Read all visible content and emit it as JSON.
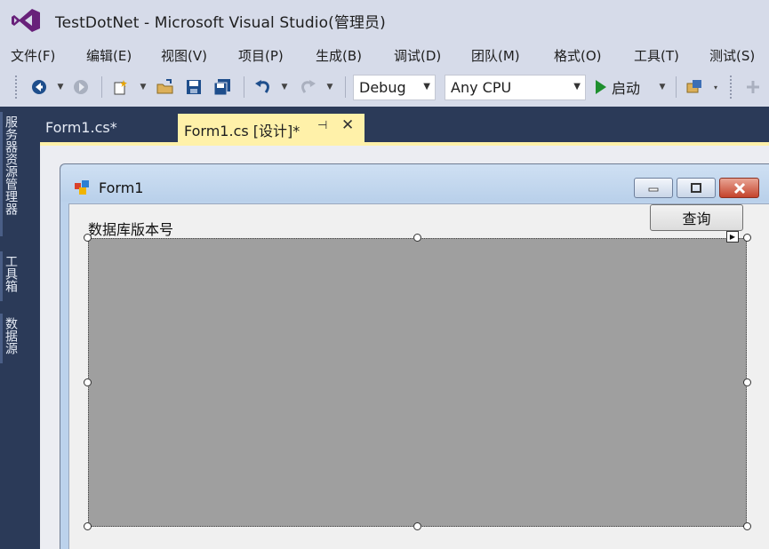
{
  "window": {
    "title": "TestDotNet - Microsoft Visual Studio(管理员)"
  },
  "menu": {
    "items": [
      "文件(F)",
      "编辑(E)",
      "视图(V)",
      "项目(P)",
      "生成(B)",
      "调试(D)",
      "团队(M)",
      "格式(O)",
      "工具(T)",
      "测试(S)"
    ]
  },
  "toolbar": {
    "config": "Debug",
    "platform": "Any CPU",
    "start_label": "启动"
  },
  "side_tabs": [
    "服务器资源管理器",
    "工具箱",
    "数据源"
  ],
  "tabs": {
    "inactive_label": "Form1.cs*",
    "active_label": "Form1.cs [设计]*"
  },
  "form": {
    "title": "Form1",
    "label_text": "数据库版本号",
    "query_button": "查询"
  },
  "colors": {
    "accent": "#fff1a9",
    "panel": "#2b3a58",
    "chrome": "#d6dbe9"
  }
}
